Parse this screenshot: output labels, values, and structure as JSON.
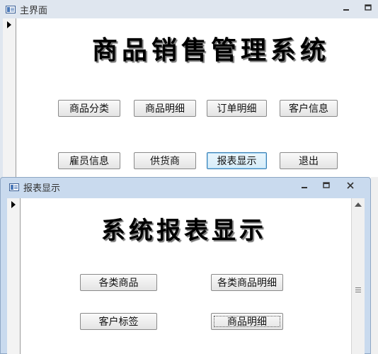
{
  "main_window": {
    "title": "主界面",
    "heading": "商品销售管理系统",
    "buttons": [
      "商品分类",
      "商品明细",
      "订单明细",
      "客户信息",
      "雇员信息",
      "供货商",
      "报表显示",
      "退出"
    ]
  },
  "report_window": {
    "title": "报表显示",
    "heading": "系统报表显示",
    "buttons": [
      "各类商品",
      "各类商品明细",
      "客户标签",
      "商品明细"
    ]
  },
  "icons": {
    "form_icon": "form-icon",
    "minimize": "minimize-icon",
    "restore": "restore-icon",
    "close": "close-icon",
    "record_selector": "record-selector-arrow-icon"
  },
  "colors": {
    "main_frame": "#dfe6ef",
    "report_frame": "#c9daee",
    "button_face": "#ececec",
    "focused_button": "#dbeefa"
  }
}
